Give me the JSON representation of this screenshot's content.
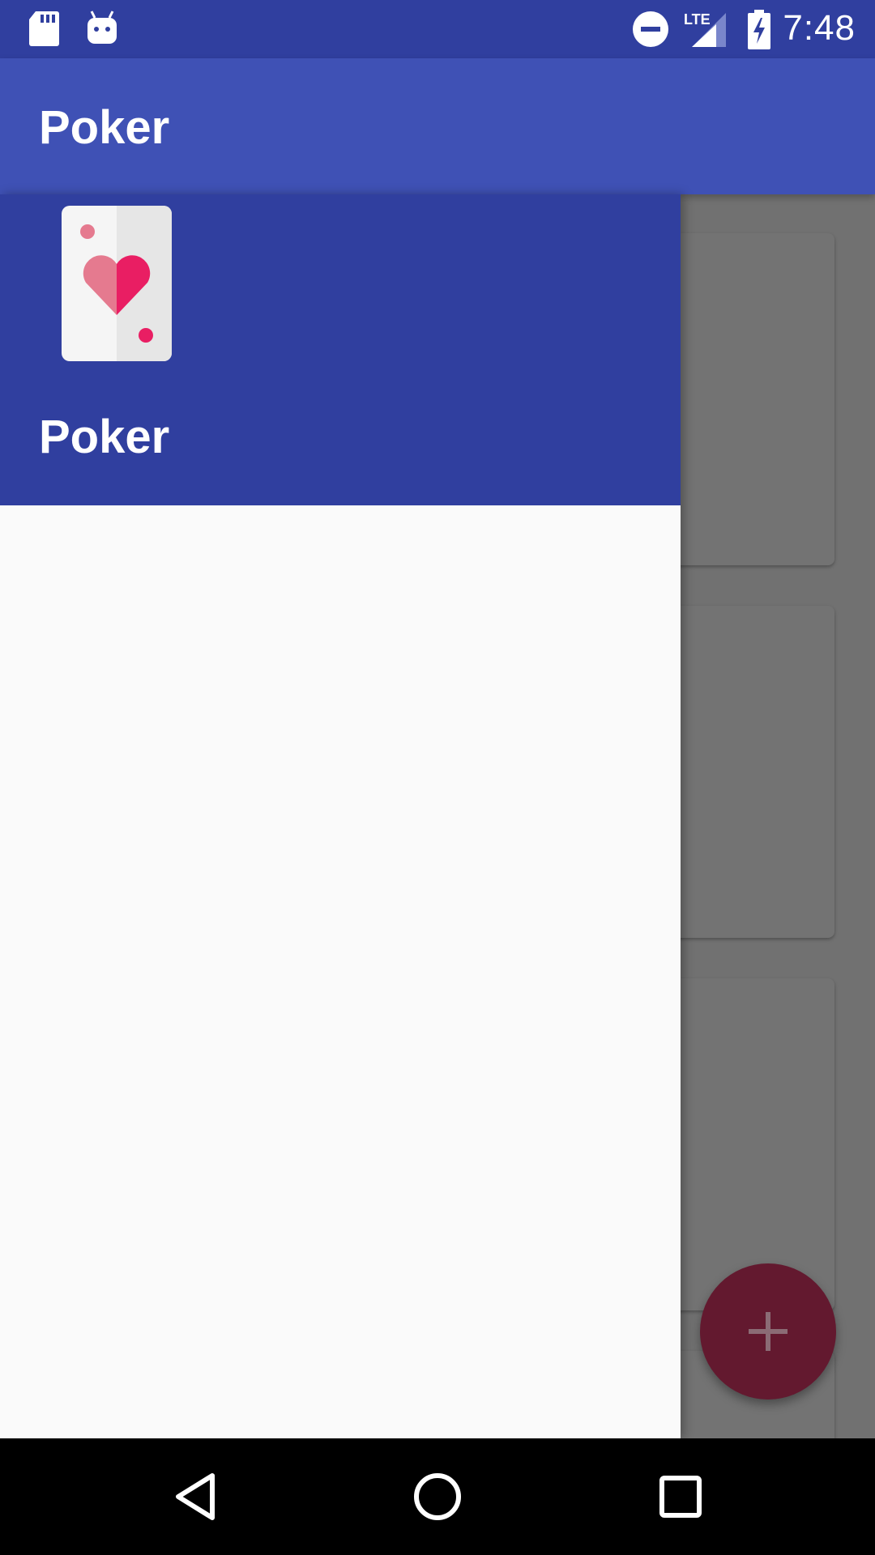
{
  "status_bar": {
    "time": "7:48",
    "left_icons": [
      "sd-card-icon",
      "android-debug-icon"
    ],
    "right_icons": [
      "do-not-disturb-icon",
      "lte-signal-icon",
      "battery-charging-icon"
    ],
    "network_label": "LTE"
  },
  "app_bar": {
    "title": "Poker",
    "color": "#3f51b5"
  },
  "drawer": {
    "header_title": "Poker",
    "header_color": "#303f9f",
    "logo_icon": "playing-card-heart-icon"
  },
  "fab": {
    "icon": "plus-icon",
    "color": "#c2185b"
  },
  "nav_bar": {
    "buttons": [
      "back-icon",
      "home-icon",
      "recents-icon"
    ]
  }
}
